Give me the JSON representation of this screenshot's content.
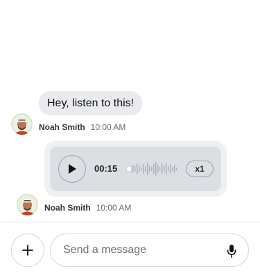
{
  "messages": [
    {
      "type": "text",
      "text": "Hey, listen to this!",
      "author": "Noah Smith",
      "time": "10:00 AM"
    },
    {
      "type": "voice",
      "duration": "00:15",
      "speed": "x1",
      "progress": 0,
      "author": "Noah Smith",
      "time": "10:00 AM"
    }
  ],
  "composer": {
    "placeholder": "Send a message",
    "value": ""
  },
  "icons": {
    "add": "plus-icon",
    "mic": "microphone-icon",
    "play": "play-icon"
  }
}
